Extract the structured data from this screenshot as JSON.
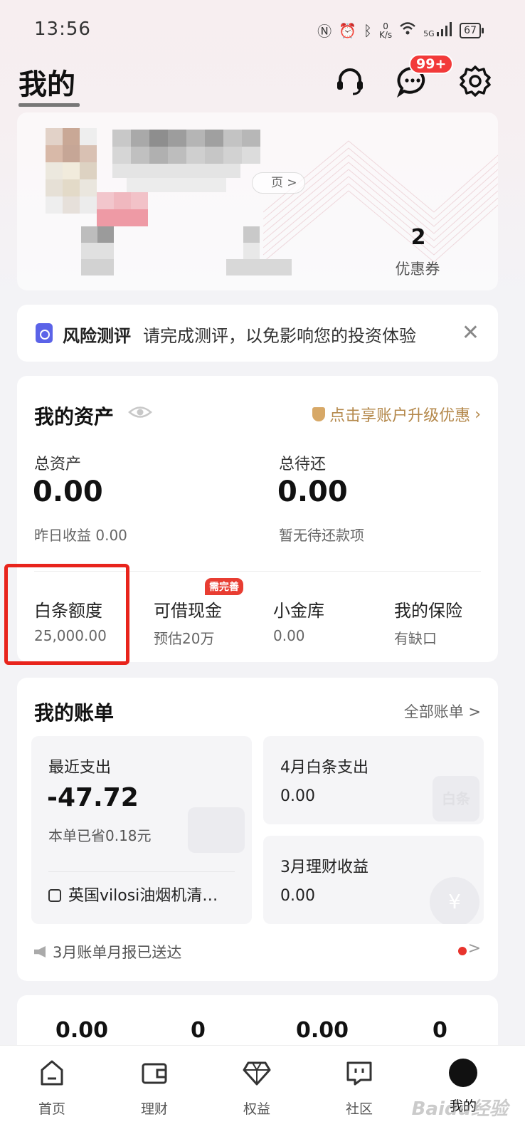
{
  "status_bar": {
    "time": "13:56",
    "net_speed_value": "0",
    "net_speed_unit": "K/s",
    "network": "5G",
    "battery": "67"
  },
  "header": {
    "title": "我的",
    "message_badge": "99+"
  },
  "profile": {
    "coupon_count": "2",
    "coupon_label": "优惠券",
    "vip_link_fragment": "页 >"
  },
  "risk_banner": {
    "title": "风险测评",
    "text": "请完成测评，以免影响您的投资体验",
    "close_glyph": "✕"
  },
  "assets": {
    "title": "我的资产",
    "upgrade_text": "点击享账户升级优惠",
    "total_assets_label": "总资产",
    "total_assets_value": "0.00",
    "yesterday_income": "昨日收益 0.00",
    "total_repay_label": "总待还",
    "total_repay_value": "0.00",
    "repay_status": "暂无待还款项",
    "items": [
      {
        "label": "白条额度",
        "sub": "25,000.00"
      },
      {
        "label": "可借现金",
        "sub": "预估20万",
        "badge": "需完善"
      },
      {
        "label": "小金库",
        "sub": "0.00"
      },
      {
        "label": "我的保险",
        "sub": "有缺口"
      }
    ]
  },
  "bills": {
    "title": "我的账单",
    "all_link": "全部账单 >",
    "recent_label": "最近支出",
    "recent_value": "-47.72",
    "recent_saved": "本单已省0.18元",
    "recent_item": "英国vilosi油烟机清…",
    "april_label": "4月白条支出",
    "april_value": "0.00",
    "april_deco": "白条",
    "march_label": "3月理财收益",
    "march_value": "0.00",
    "march_deco": "¥",
    "report_text": "3月账单月报已送达",
    "report_chevron": ">"
  },
  "stats": {
    "values": [
      "0.00",
      "0",
      "0.00",
      "0"
    ]
  },
  "bottom_nav": {
    "items": [
      {
        "label": "首页",
        "icon": "home-icon"
      },
      {
        "label": "理财",
        "icon": "wallet-icon"
      },
      {
        "label": "权益",
        "icon": "diamond-icon"
      },
      {
        "label": "社区",
        "icon": "chat-icon"
      },
      {
        "label": "我的",
        "icon": "mine-icon"
      }
    ],
    "active_index": 4
  },
  "watermark": "Baidu经验",
  "colors": {
    "accent_gold": "#b4884b",
    "badge_red": "#f23a3a",
    "highlight_red": "#e8241c",
    "risk_blue": "#5b63e8"
  }
}
